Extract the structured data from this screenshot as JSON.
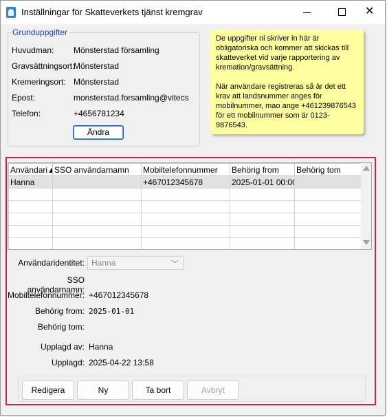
{
  "window": {
    "title": "Inställningar för Skatteverkets tjänst kremgrav",
    "minimize": "minimize",
    "maximize": "maximize",
    "close": "✕"
  },
  "group": {
    "legend": "Grunduppgifter",
    "fields": [
      {
        "label": "Huvudman:",
        "value": "Mönsterstad församling"
      },
      {
        "label": "Gravsättningsort:",
        "value": "Mönsterstad"
      },
      {
        "label": "Kremeringsort:",
        "value": "Mönsterstad"
      },
      {
        "label": "Epost:",
        "value": "monsterstad.forsamling@vitecsoftw"
      },
      {
        "label": "Telefon:",
        "value": "+4656781234"
      }
    ],
    "change_label": "Ändra"
  },
  "note": {
    "p1": "De uppgifter ni skriver in här är obligatoriska och kommer att skickas till skatteverket vid varje rapportering av kremation/gravsättning.",
    "p2": "När användare registreras så är det ett krav att landsnummer anges för mobilnummer, mao ange +461239876543 för ett mobilnummer som är 0123-9876543."
  },
  "grid": {
    "columns": [
      "Användari▲",
      "SSO användarnamn",
      "Mobiltelefonnummer",
      "Behörig from",
      "Behörig tom"
    ],
    "rows": [
      [
        "Hanna",
        "",
        "+467012345678",
        "2025-01-01 00:00",
        ""
      ]
    ]
  },
  "form": {
    "identity_label": "Användaridentitet:",
    "identity_value": "Hanna",
    "sso_label": "SSO användarnamn:",
    "sso_value": "",
    "mobile_label": "Mobiltelefonnummer:",
    "mobile_value": "+467012345678",
    "from_label": "Behörig from:",
    "from_value": "2025-01-01",
    "tom_label": "Behörig tom:",
    "tom_value": "",
    "created_by_label": "Upplagd av:",
    "created_by_value": "Hanna",
    "created_label": "Upplagd:",
    "created_value": "2025-04-22 13:58"
  },
  "buttons": {
    "edit": "Redigera",
    "new": "Ny",
    "delete": "Ta bort",
    "cancel": "Avbryt"
  },
  "colors": {
    "accent_frame": "#c8234a",
    "note_bg": "#ffffa0",
    "legend": "#1a3fbf"
  }
}
